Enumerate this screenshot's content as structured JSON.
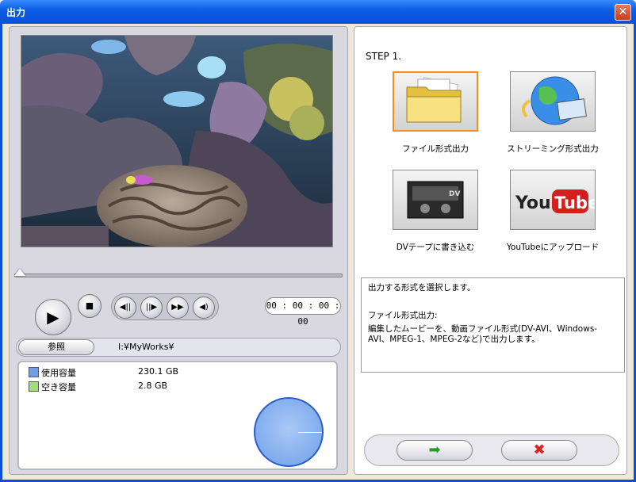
{
  "window": {
    "title": "出力",
    "close_glyph": "✕"
  },
  "player": {
    "timecode": "00 : 00 : 00 : 00",
    "buttons": {
      "play": "▶",
      "stop": "■",
      "prev_frame": "◀||",
      "next_frame": "||▶",
      "fast_forward": "▶▶",
      "mute": "◀)"
    }
  },
  "browse": {
    "button_label": "参照",
    "path": "I:¥MyWorks¥"
  },
  "disk": {
    "used": {
      "label": "使用容量",
      "value": "230.1  GB",
      "color": "#6f9fe8"
    },
    "free": {
      "label": "空き容量",
      "value": "2.8  GB",
      "color": "#9fe07c"
    }
  },
  "step": {
    "title": "STEP 1."
  },
  "options": [
    {
      "label": "ファイル形式出力",
      "icon": "folder-icon",
      "selected": true
    },
    {
      "label": "ストリーミング形式出力",
      "icon": "globe-icon",
      "selected": false
    },
    {
      "label": "DVテープに書き込む",
      "icon": "dv-tape-icon",
      "selected": false
    },
    {
      "label": "YouTubeにアップロード",
      "icon": "youtube-icon",
      "selected": false
    }
  ],
  "description": {
    "line1": "出力する形式を選択します。",
    "heading": "ファイル形式出力:",
    "body": "編集したムービーを、動画ファイル形式(DV-AVI、Windows-AVI、MPEG-1、MPEG-2など)で出力します。"
  },
  "footer": {
    "ok_glyph": "➡",
    "cancel_glyph": "✖"
  },
  "colors": {
    "title_bar": "#0a50d8",
    "selection_border": "#f0901a"
  }
}
